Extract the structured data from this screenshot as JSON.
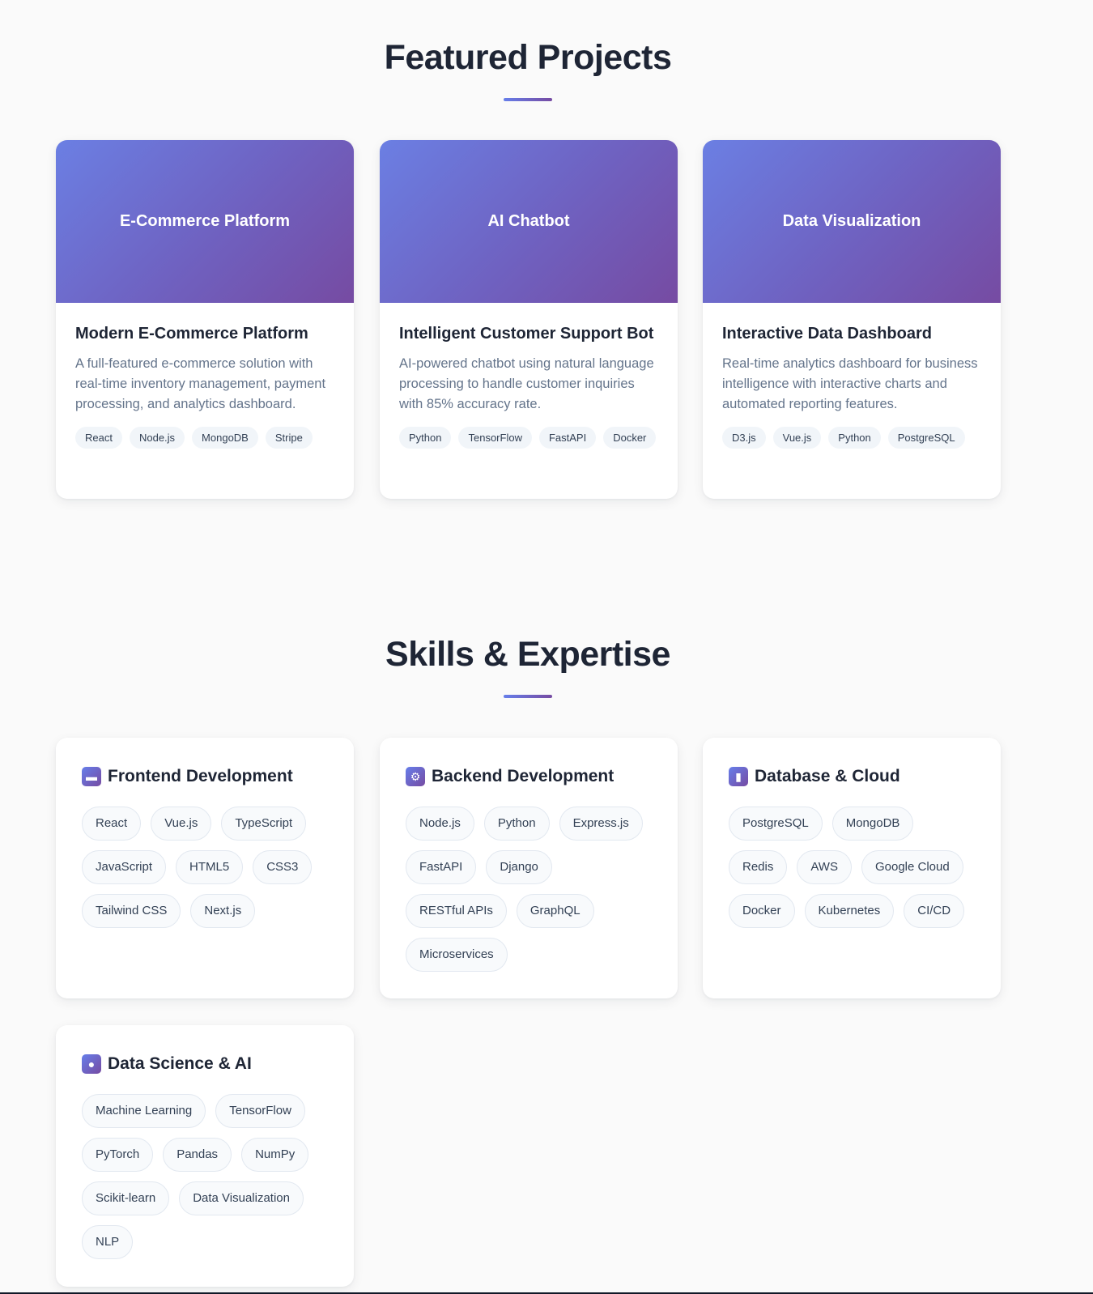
{
  "projects_section": {
    "title": "Featured Projects",
    "cards": [
      {
        "banner": "E-Commerce Platform",
        "title": "Modern E-Commerce Platform",
        "description": "A full-featured e-commerce solution with real-time inventory management, payment processing, and analytics dashboard.",
        "tags": [
          "React",
          "Node.js",
          "MongoDB",
          "Stripe"
        ]
      },
      {
        "banner": "AI Chatbot",
        "title": "Intelligent Customer Support Bot",
        "description": "AI-powered chatbot using natural language processing to handle customer inquiries with 85% accuracy rate.",
        "tags": [
          "Python",
          "TensorFlow",
          "FastAPI",
          "Docker"
        ]
      },
      {
        "banner": "Data Visualization",
        "title": "Interactive Data Dashboard",
        "description": "Real-time analytics dashboard for business intelligence with interactive charts and automated reporting features.",
        "tags": [
          "D3.js",
          "Vue.js",
          "Python",
          "PostgreSQL"
        ]
      }
    ]
  },
  "skills_section": {
    "title": "Skills & Expertise",
    "cards": [
      {
        "icon": "laptop-icon",
        "icon_glyph": "▬",
        "title": "Frontend Development",
        "skills": [
          "React",
          "Vue.js",
          "TypeScript",
          "JavaScript",
          "HTML5",
          "CSS3",
          "Tailwind CSS",
          "Next.js"
        ]
      },
      {
        "icon": "gear-icon",
        "icon_glyph": "⚙",
        "title": "Backend Development",
        "skills": [
          "Node.js",
          "Python",
          "Express.js",
          "FastAPI",
          "Django",
          "RESTful APIs",
          "GraphQL",
          "Microservices"
        ]
      },
      {
        "icon": "database-icon",
        "icon_glyph": "▮",
        "title": "Database & Cloud",
        "skills": [
          "PostgreSQL",
          "MongoDB",
          "Redis",
          "AWS",
          "Google Cloud",
          "Docker",
          "Kubernetes",
          "CI/CD"
        ]
      },
      {
        "icon": "brain-icon",
        "icon_glyph": "●",
        "title": "Data Science & AI",
        "skills": [
          "Machine Learning",
          "TensorFlow",
          "PyTorch",
          "Pandas",
          "NumPy",
          "Scikit-learn",
          "Data Visualization",
          "NLP"
        ]
      }
    ]
  },
  "colors": {
    "accent_start": "#667eea",
    "accent_end": "#764ba2",
    "background": "#fafafa",
    "heading": "#1e2535",
    "body_text": "#64748b"
  }
}
